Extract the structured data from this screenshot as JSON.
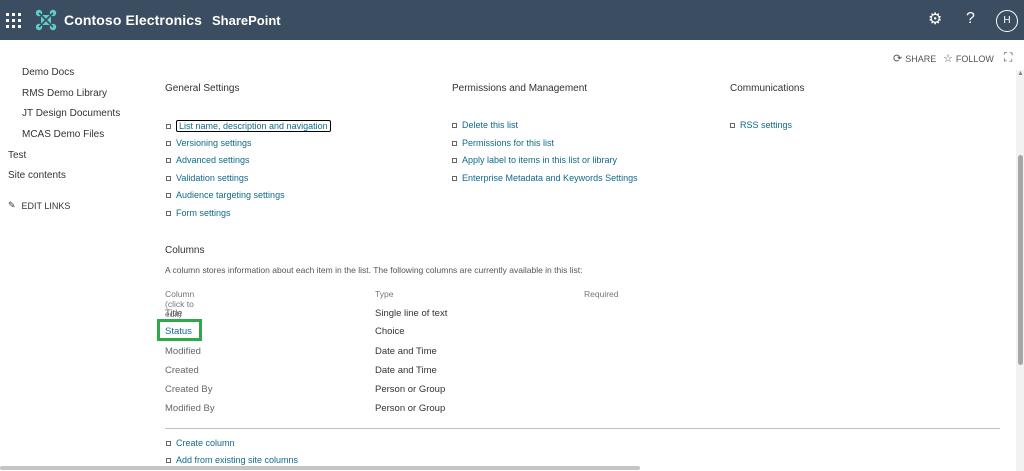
{
  "header": {
    "app_title": "Contoso Electronics",
    "suite_title": "SharePoint",
    "avatar_initial": "H",
    "help_glyph": "?",
    "bg_color": "#3b4d61"
  },
  "command_bar": {
    "share_label": "SHARE",
    "follow_label": "FOLLOW"
  },
  "left_nav": {
    "items": [
      "Demo Docs",
      "RMS Demo Library",
      "JT Design Documents",
      "MCAS Demo Files",
      "Test",
      "Site contents"
    ],
    "edit_links": "EDIT LINKS"
  },
  "general_settings": {
    "title": "General Settings",
    "links": [
      "List name, description and navigation",
      "Versioning settings",
      "Advanced settings",
      "Validation settings",
      "Audience targeting settings",
      "Form settings"
    ]
  },
  "permissions": {
    "title": "Permissions and Management",
    "links": [
      "Delete this list",
      "Permissions for this list",
      "Apply label to items in this list or library",
      "Enterprise Metadata and Keywords Settings"
    ]
  },
  "communications": {
    "title": "Communications",
    "links": [
      "RSS settings"
    ]
  },
  "columns": {
    "title": "Columns",
    "description": "A column stores information about each item in the list. The following columns are currently available in this list:",
    "headers": [
      "Column (click to edit)",
      "Type",
      "Required"
    ],
    "rows": [
      {
        "name": "Title",
        "type": "Single line of text"
      },
      {
        "name": "Status",
        "type": "Choice"
      },
      {
        "name": "Modified",
        "type": "Date and Time"
      },
      {
        "name": "Created",
        "type": "Date and Time"
      },
      {
        "name": "Created By",
        "type": "Person or Group"
      },
      {
        "name": "Modified By",
        "type": "Person or Group"
      }
    ],
    "actions": [
      "Create column",
      "Add from existing site columns"
    ]
  },
  "colors": {
    "link": "#0f6a8a",
    "highlight": "#2ea84a"
  }
}
